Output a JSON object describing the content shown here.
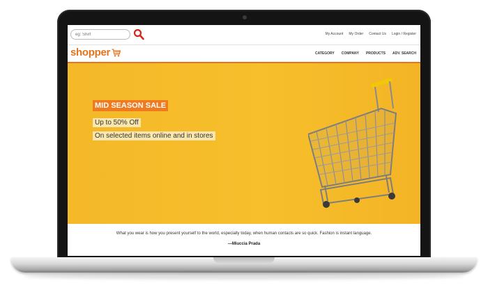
{
  "search": {
    "placeholder": "eg: Shirt",
    "button_icon": "search-icon"
  },
  "top_links": [
    "My Account",
    "My Order",
    "Contact Us",
    "Login / Register"
  ],
  "brand": {
    "logo_text": "shopper",
    "logo_icon": "cart-icon",
    "color": "#e4741e"
  },
  "main_nav": [
    "CATEGORY",
    "COMPANY",
    "PRODUCTS",
    "ADV. SEARCH"
  ],
  "hero": {
    "badge": "MID SEASON SALE",
    "line1": "Up to 50% Off",
    "line2": "On selected items online and in stores",
    "background": "#f6bb2a",
    "badge_color": "#f07a1e",
    "image": "shopping-cart-image"
  },
  "quote": {
    "text": "What you wear is how you present yourself to the world, especially today, when human contacts are so quick. Fashion is instant language.",
    "author": "—Miuccia Prada"
  }
}
